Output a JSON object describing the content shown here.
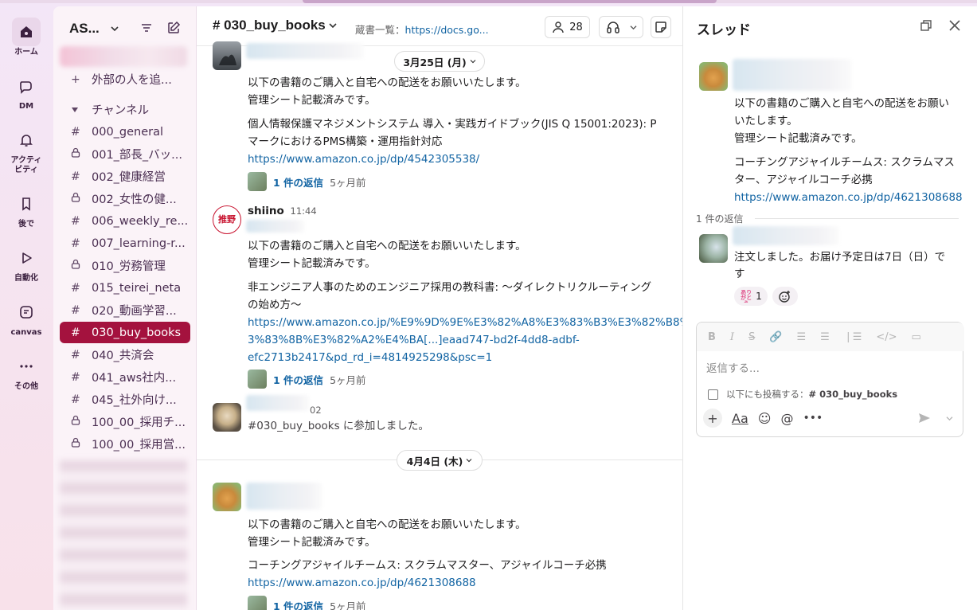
{
  "rail": {
    "items": [
      {
        "label": "ホーム",
        "icon": "home-icon"
      },
      {
        "label": "DM",
        "icon": "dm-icon"
      },
      {
        "label": "アクティ\nビティ",
        "icon": "bell-icon"
      },
      {
        "label": "後で",
        "icon": "bookmark-icon"
      },
      {
        "label": "自動化",
        "icon": "play-icon"
      },
      {
        "label": "canvas",
        "icon": "canvas-icon"
      },
      {
        "label": "その他",
        "icon": "more-icon"
      }
    ]
  },
  "sidebar": {
    "workspace": "AS...",
    "add_external": "外部の人を追...",
    "section": "チャンネル",
    "channels": [
      {
        "sym": "#",
        "name": "000_general"
      },
      {
        "sym": "lock",
        "name": "001_部長_バッ..."
      },
      {
        "sym": "#",
        "name": "002_健康経営"
      },
      {
        "sym": "lock",
        "name": "002_女性の健..."
      },
      {
        "sym": "#",
        "name": "006_weekly_re..."
      },
      {
        "sym": "#",
        "name": "007_learning-r..."
      },
      {
        "sym": "lock",
        "name": "010_労務管理"
      },
      {
        "sym": "#",
        "name": "015_teirei_neta"
      },
      {
        "sym": "#",
        "name": "020_動画学習..."
      },
      {
        "sym": "#",
        "name": "030_buy_books"
      },
      {
        "sym": "#",
        "name": "040_共済会"
      },
      {
        "sym": "#",
        "name": "041_aws社内..."
      },
      {
        "sym": "#",
        "name": "045_社外向け..."
      },
      {
        "sym": "lock",
        "name": "100_00_採用チ..."
      },
      {
        "sym": "lock",
        "name": "100_00_採用営..."
      }
    ],
    "active_channel": "030_buy_books"
  },
  "channel": {
    "title": "# 030_buy_books",
    "topic_label": "蔵書一覧：",
    "topic_link": "https://docs.go...",
    "member_count": "28"
  },
  "messages": {
    "date1": "3月25日 (月)",
    "m1": {
      "line1": "以下の書籍のご購入と自宅への配送をお願いいたします。",
      "line2": "管理シート記載済みです。",
      "book1": "個人情報保護マネジメントシステム 導入・実践ガイドブック(JIS Q 15001:2023): P",
      "book2": "マークにおけるPMS構築・運用指針対応",
      "url": "https://www.amazon.co.jp/dp/4542305538/",
      "replies": "1 件の返信",
      "ago": "5ヶ月前"
    },
    "m2": {
      "author": "shiino",
      "time": "11:44",
      "avatar_text": "推野",
      "line1": "以下の書籍のご購入と自宅への配送をお願いいたします。",
      "line2": "管理シート記載済みです。",
      "book1": "非エンジニア人事のためのエンジニア採用の教科書: ～ダイレクトリクルーティング",
      "book2": "の始め方～",
      "url1": "https://www.amazon.co.jp/%E9%9D%9E%E3%82%A8%E3%83%B3%E3%82%B8%E",
      "url2": "3%83%8B%E3%82%A2%E4%BA[...]eaad747-bd2f-4dd8-adbf-",
      "url3": "efc2713b2417&pd_rd_i=4814925298&psc=1",
      "replies": "1 件の返信",
      "ago": "5ヶ月前"
    },
    "m3": {
      "time_tail": "02",
      "join": "#030_buy_books に参加しました。"
    },
    "date2": "4月4日 (木)",
    "m4": {
      "line1": "以下の書籍のご購入と自宅への配送をお願いいたします。",
      "line2": "管理シート記載済みです。",
      "book": "コーチングアジャイルチームス: スクラムマスター、アジャイルコーチ必携",
      "url": "https://www.amazon.co.jp/dp/4621308688",
      "replies": "1 件の返信",
      "ago": "5ヶ月前"
    }
  },
  "thread": {
    "title": "スレッド",
    "parent": {
      "line1": "以下の書籍のご購入と自宅への配送をお願い",
      "line2": "いたします。",
      "line3": "管理シート記載済みです。",
      "book1": "コーチングアジャイルチームス: スクラムマス",
      "book2": "ター、アジャイルコーチ必携",
      "url": "https://www.amazon.co.jp/dp/4621308688"
    },
    "reply_count": "1 件の返信",
    "reply": {
      "line1": "注文しました。お届け予定日は7日（日）で",
      "line2": "す",
      "reaction_emoji": "ありがとう",
      "reaction_count": "1"
    },
    "composer": {
      "placeholder": "返信する...",
      "also_send": "以下にも投稿する：",
      "also_channel": "# 030_buy_books",
      "format_label": "Aa"
    }
  },
  "colors": {
    "active_channel_bg": "#a4123e",
    "link": "#1264a3"
  }
}
